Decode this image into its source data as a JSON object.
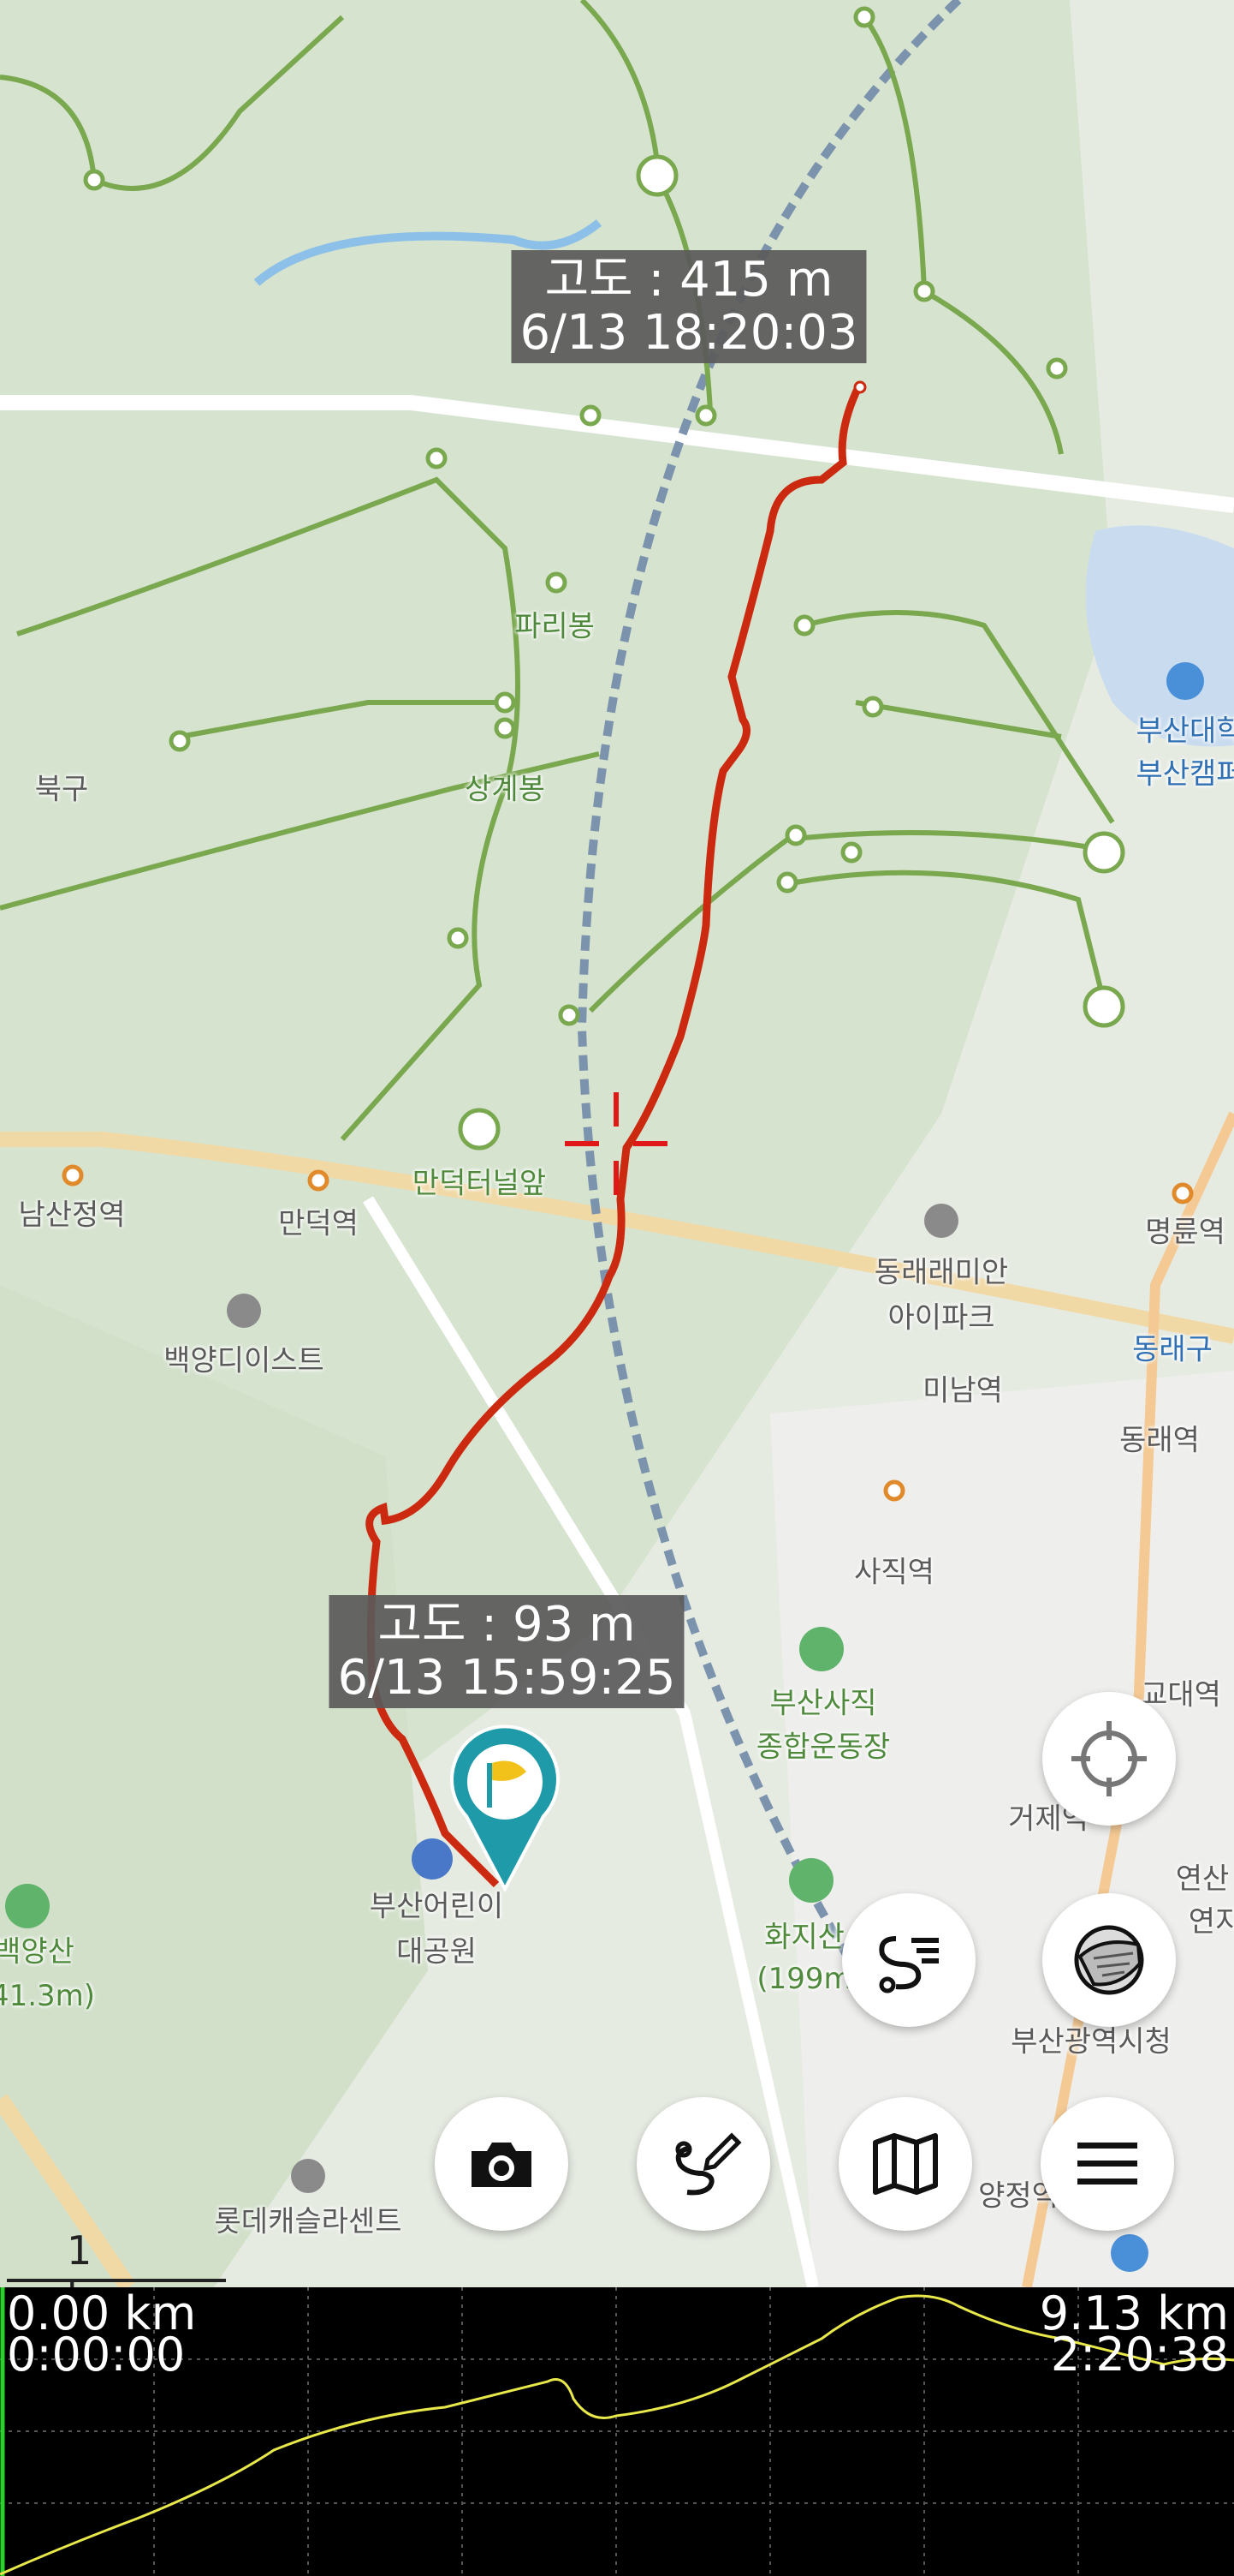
{
  "map": {
    "places": [
      {
        "id": "paribong",
        "label": "파리봉",
        "cls": "green"
      },
      {
        "id": "sanggyebong",
        "label": "상계봉",
        "cls": "green"
      },
      {
        "id": "bukgu",
        "label": "북구",
        "cls": "gray"
      },
      {
        "id": "busan-univ",
        "label": "부산대학",
        "cls": "blue"
      },
      {
        "id": "busan-campus",
        "label": "부산캠퍼",
        "cls": "blue"
      },
      {
        "id": "namsan",
        "label": "남산정역",
        "cls": "gray"
      },
      {
        "id": "mandeok",
        "label": "만덕역",
        "cls": "gray"
      },
      {
        "id": "mandeok-tunnel",
        "label": "만덕터널앞",
        "cls": "green"
      },
      {
        "id": "myeongnyun",
        "label": "명륜역",
        "cls": "gray"
      },
      {
        "id": "dongnae-raemian",
        "label": "동래래미안",
        "cls": "gray"
      },
      {
        "id": "ipark",
        "label": "아이파크",
        "cls": "gray"
      },
      {
        "id": "baekyang-east",
        "label": "백양디이스트",
        "cls": "gray"
      },
      {
        "id": "minam",
        "label": "미남역",
        "cls": "gray"
      },
      {
        "id": "dongnaegu",
        "label": "동래구",
        "cls": "blue"
      },
      {
        "id": "dongnae-st",
        "label": "동래역",
        "cls": "gray"
      },
      {
        "id": "sajik",
        "label": "사직역",
        "cls": "gray"
      },
      {
        "id": "sajik-stadium1",
        "label": "부산사직",
        "cls": "green"
      },
      {
        "id": "sajik-stadium2",
        "label": "종합운동장",
        "cls": "green"
      },
      {
        "id": "gyodae",
        "label": "교대역",
        "cls": "gray"
      },
      {
        "id": "geoje",
        "label": "거제역",
        "cls": "gray"
      },
      {
        "id": "yeonsan",
        "label": "연산",
        "cls": "gray"
      },
      {
        "id": "yeon2",
        "label": "연지",
        "cls": "gray"
      },
      {
        "id": "childrens-park1",
        "label": "부산어린이",
        "cls": "gray"
      },
      {
        "id": "childrens-park2",
        "label": "대공원",
        "cls": "gray"
      },
      {
        "id": "hwaji",
        "label": "화지산",
        "cls": "green"
      },
      {
        "id": "hwaji-h",
        "label": "(199m",
        "cls": "green"
      },
      {
        "id": "baekyangsan",
        "label": "백양산",
        "cls": "green"
      },
      {
        "id": "baekyang-h",
        "label": "41.3m)",
        "cls": "green"
      },
      {
        "id": "cityhall",
        "label": "부산광역시청",
        "cls": "gray"
      },
      {
        "id": "lotte",
        "label": "롯데캐슬라센트",
        "cls": "gray"
      },
      {
        "id": "yangjeong",
        "label": "양정역",
        "cls": "gray"
      }
    ],
    "callouts": {
      "end": {
        "alt": "고도 : 415 m",
        "time": "6/13 18:20:03"
      },
      "start": {
        "alt": "고도 : 93 m",
        "time": "6/13 15:59:25"
      }
    },
    "scale_label": "1 km"
  },
  "buttons": {
    "locate": "crosshair-icon",
    "route": "route-list-icon",
    "layers": "layers-icon",
    "camera": "camera-icon",
    "draw": "draw-route-icon",
    "map": "map-icon",
    "menu": "menu-icon"
  },
  "profile": {
    "start_distance": "0.00 km",
    "start_time": "0:00:00",
    "end_distance": "9.13 km",
    "end_time": "2:20:38",
    "line_color": "#e8e84a"
  },
  "colors": {
    "track": "#cc2a10",
    "marker": "#1e9aa8",
    "trail": "#7aa84f"
  }
}
